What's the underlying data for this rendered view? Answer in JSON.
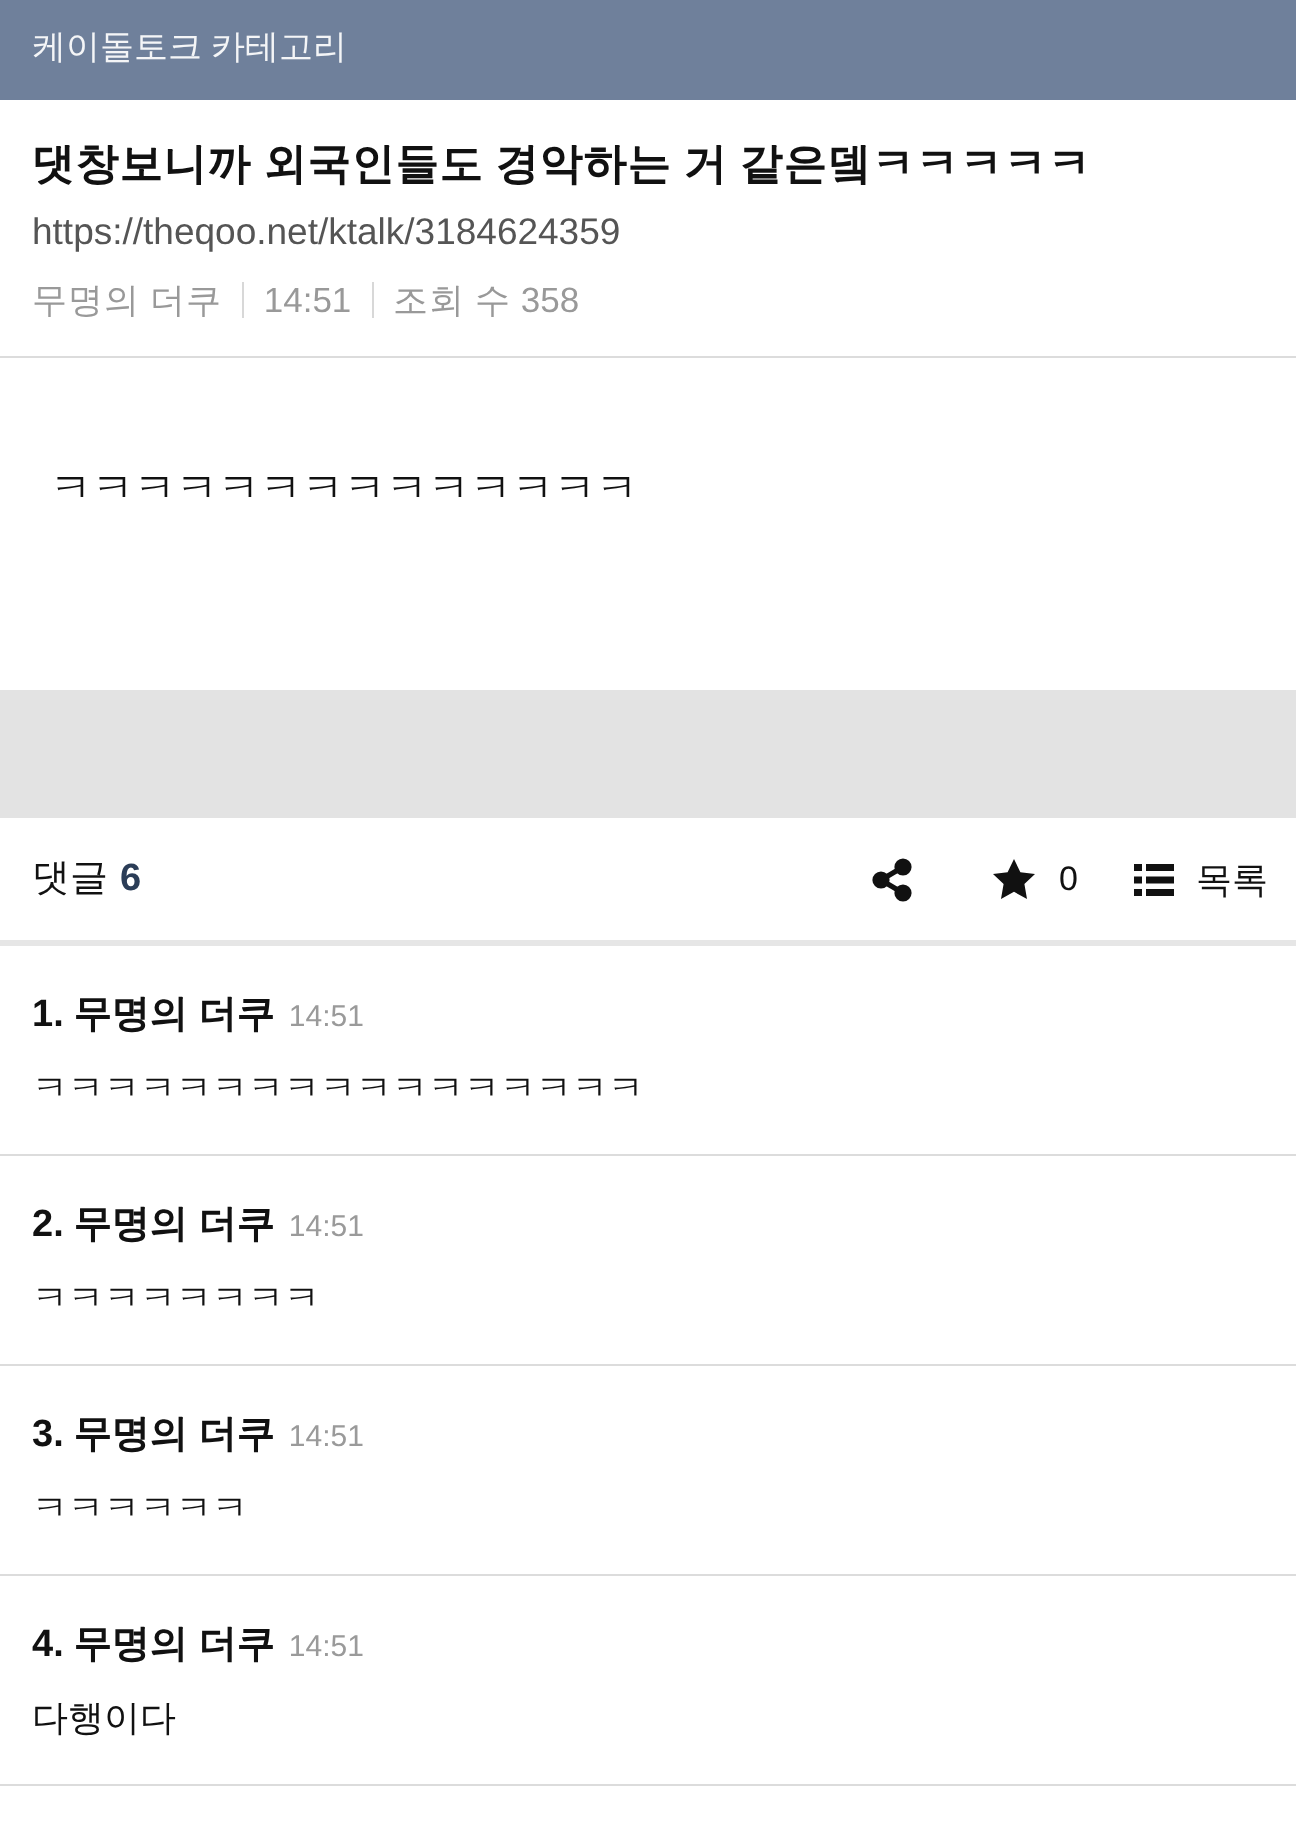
{
  "header": {
    "title": "케이돌토크 카테고리"
  },
  "post": {
    "title": "댓창보니까 외국인들도 경악하는 거 같은뎈ㅋㅋㅋㅋㅋ",
    "url": "https://theqoo.net/ktalk/3184624359",
    "meta": [
      "무명의 더쿠",
      "14:51",
      "조회 수 358"
    ],
    "body": "ㅋㅋㅋㅋㅋㅋㅋㅋㅋㅋㅋㅋㅋㅋ"
  },
  "comment_bar": {
    "label": "댓글",
    "count": "6",
    "star_count": "0",
    "list_label": "목록"
  },
  "comments": [
    {
      "author": "1. 무명의 더쿠",
      "time": "14:51",
      "text": "ㅋㅋㅋㅋㅋㅋㅋㅋㅋㅋㅋㅋㅋㅋㅋㅋㅋ"
    },
    {
      "author": "2. 무명의 더쿠",
      "time": "14:51",
      "text": "ㅋㅋㅋㅋㅋㅋㅋㅋ"
    },
    {
      "author": "3. 무명의 더쿠",
      "time": "14:51",
      "text": "ㅋㅋㅋㅋㅋㅋ"
    },
    {
      "author": "4. 무명의 더쿠",
      "time": "14:51",
      "text": "다행이다"
    }
  ]
}
